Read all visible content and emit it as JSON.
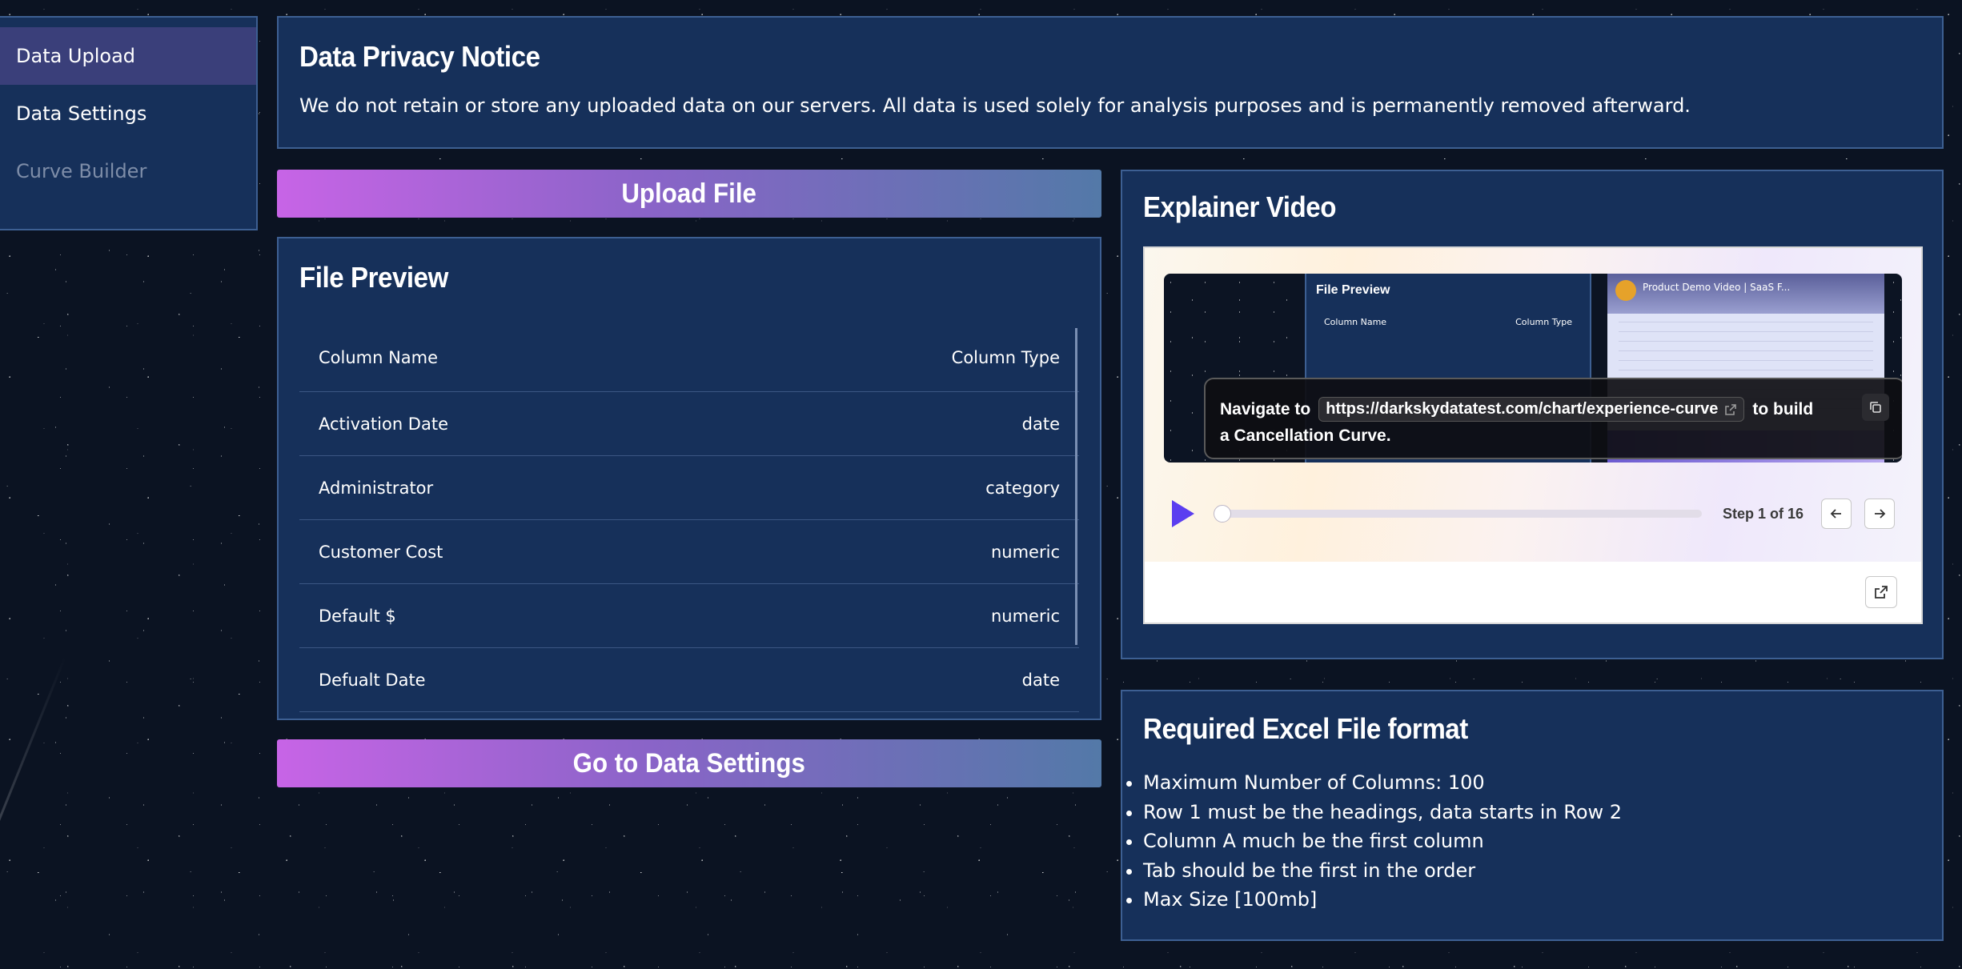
{
  "sidebar": {
    "items": [
      {
        "label": "Data Upload",
        "state": "active"
      },
      {
        "label": "Data Settings",
        "state": "normal"
      },
      {
        "label": "Curve Builder",
        "state": "disabled"
      }
    ]
  },
  "privacy": {
    "title": "Data Privacy Notice",
    "text": "We do not retain or store any uploaded data on our servers. All data is used solely for analysis purposes and is permanently removed afterward."
  },
  "upload_button": {
    "label": "Upload File"
  },
  "preview": {
    "title": "File Preview",
    "columns": [
      "Column Name",
      "Column Type"
    ],
    "rows": [
      {
        "name": "Activation Date",
        "type": "date"
      },
      {
        "name": "Administrator",
        "type": "category"
      },
      {
        "name": "Customer Cost",
        "type": "numeric"
      },
      {
        "name": "Default $",
        "type": "numeric"
      },
      {
        "name": "Defualt Date",
        "type": "date"
      }
    ]
  },
  "settings_button": {
    "label": "Go to Data Settings"
  },
  "video": {
    "title": "Explainer Video",
    "mini_preview_title": "File Preview",
    "mini_col_name": "Column Name",
    "mini_col_type": "Column Type",
    "mini_video_title": "Product Demo Video | SaaS F...",
    "callout": {
      "prefix": "Navigate to",
      "url": "https://darkskydatatest.com/chart/experience-curve",
      "suffix": "to build",
      "line2": "a Cancellation Curve."
    },
    "step_text": "Step 1 of 16",
    "progress": 0.0,
    "accent_color": "#5b3ef0"
  },
  "format": {
    "title": "Required Excel File format",
    "items": [
      "Maximum Number of Columns: 100",
      "Row 1 must be the headings, data starts in Row 2",
      "Column A much be the first column",
      "Tab should be the first in the order",
      "Max Size [100mb]"
    ]
  },
  "colors": {
    "panel": "#16305a",
    "panel_border": "#3d5f92",
    "nav_active": "#3a3f7a",
    "button_gradient_start": "#c764e6",
    "button_gradient_end": "#5379a8"
  }
}
